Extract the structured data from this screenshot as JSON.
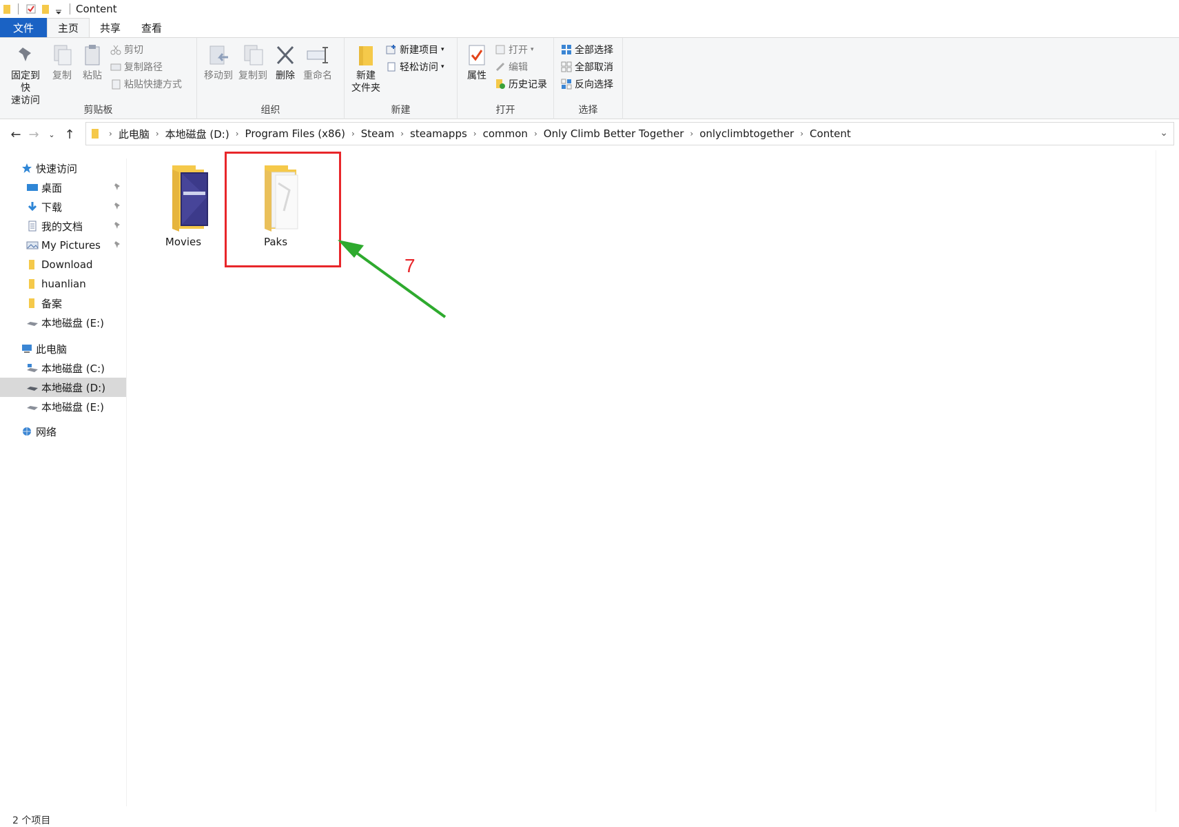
{
  "window": {
    "title": "Content"
  },
  "tabs": [
    {
      "label": "文件"
    },
    {
      "label": "主页"
    },
    {
      "label": "共享"
    },
    {
      "label": "查看"
    }
  ],
  "ribbon": {
    "clipboard": {
      "label": "剪贴板",
      "pin": "固定到快\n速访问",
      "copy": "复制",
      "paste": "粘贴",
      "cut": "剪切",
      "copy_path": "复制路径",
      "paste_shortcut": "粘贴快捷方式"
    },
    "organize": {
      "label": "组织",
      "move_to": "移动到",
      "copy_to": "复制到",
      "delete": "删除",
      "rename": "重命名"
    },
    "new": {
      "label": "新建",
      "new_folder": "新建\n文件夹",
      "new_item": "新建项目",
      "easy_access": "轻松访问"
    },
    "open": {
      "label": "打开",
      "properties": "属性",
      "open": "打开",
      "edit": "编辑",
      "history": "历史记录"
    },
    "select": {
      "label": "选择",
      "select_all": "全部选择",
      "select_none": "全部取消",
      "invert": "反向选择"
    }
  },
  "address": {
    "crumbs": [
      "此电脑",
      "本地磁盘 (D:)",
      "Program Files (x86)",
      "Steam",
      "steamapps",
      "common",
      "Only Climb Better Together",
      "onlyclimbtogether",
      "Content"
    ]
  },
  "sidebar": {
    "quick_access": "快速访问",
    "quick_items": [
      "桌面",
      "下载",
      "我的文档",
      "My Pictures",
      "Download",
      "huanlian",
      "备案",
      "本地磁盘 (E:)"
    ],
    "this_pc": "此电脑",
    "pc_items": [
      "本地磁盘 (C:)",
      "本地磁盘 (D:)",
      "本地磁盘 (E:)"
    ],
    "network": "网络"
  },
  "files": [
    {
      "name": "Movies"
    },
    {
      "name": "Paks"
    }
  ],
  "annotation": {
    "number": "7"
  },
  "status": {
    "count": "2 个项目"
  },
  "colors": {
    "accent": "#1a62c4",
    "highlight": "#e8262a",
    "arrow": "#2eaa2e",
    "folder": "#f5c94a"
  }
}
